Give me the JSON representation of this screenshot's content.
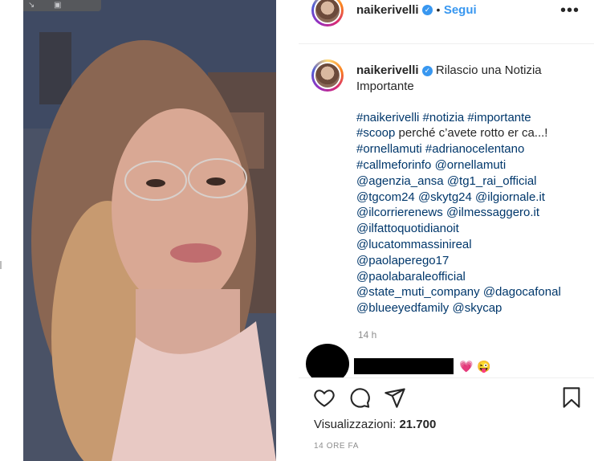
{
  "video_overlay": {
    "icon_left": "↘",
    "icon_right": "▣"
  },
  "header": {
    "username": "naikerivelli",
    "separator": "•",
    "follow_label": "Segui",
    "more_label": "•••"
  },
  "caption": {
    "username": "naikerivelli",
    "title": "Rilascio una Notizia Importante",
    "lines": [
      {
        "parts": [
          {
            "t": "#naikerivelli",
            "tag": true
          },
          {
            "t": " "
          },
          {
            "t": "#notizia",
            "tag": true
          },
          {
            "t": " "
          },
          {
            "t": "#importante",
            "tag": true
          }
        ]
      },
      {
        "parts": [
          {
            "t": "#scoop",
            "tag": true
          },
          {
            "t": " perché c’avete rotto er ca...!"
          }
        ]
      },
      {
        "parts": [
          {
            "t": "#ornellamuti",
            "tag": true
          },
          {
            "t": " "
          },
          {
            "t": "#adrianocelentano",
            "tag": true
          }
        ]
      },
      {
        "parts": [
          {
            "t": "#callmeforinfo",
            "tag": true
          },
          {
            "t": " "
          },
          {
            "t": "@ornellamuti",
            "tag": true
          }
        ]
      },
      {
        "parts": [
          {
            "t": "@agenzia_ansa",
            "tag": true
          },
          {
            "t": " "
          },
          {
            "t": "@tg1_rai_official",
            "tag": true
          }
        ]
      },
      {
        "parts": [
          {
            "t": "@tgcom24",
            "tag": true
          },
          {
            "t": " "
          },
          {
            "t": "@skytg24",
            "tag": true
          },
          {
            "t": " "
          },
          {
            "t": "@ilgiornale.it",
            "tag": true
          }
        ]
      },
      {
        "parts": [
          {
            "t": "@ilcorrierenews",
            "tag": true
          },
          {
            "t": " "
          },
          {
            "t": "@ilmessaggero.it",
            "tag": true
          }
        ]
      },
      {
        "parts": [
          {
            "t": "@ilfattoquotidianoit",
            "tag": true
          }
        ]
      },
      {
        "parts": [
          {
            "t": "@lucatommassinireal",
            "tag": true
          }
        ]
      },
      {
        "parts": [
          {
            "t": "@paolaperego17",
            "tag": true
          }
        ]
      },
      {
        "parts": [
          {
            "t": "@paolabaraleofficial",
            "tag": true
          }
        ]
      },
      {
        "parts": [
          {
            "t": "@state_muti_company",
            "tag": true
          },
          {
            "t": " "
          },
          {
            "t": "@dagocafonal",
            "tag": true
          }
        ]
      },
      {
        "parts": [
          {
            "t": "@blueeyedfamily",
            "tag": true
          },
          {
            "t": " "
          },
          {
            "t": "@skycap",
            "tag": true
          }
        ]
      }
    ],
    "time_ago": "14 h"
  },
  "comment": {
    "emoji_1": "💗",
    "emoji_2": "😜"
  },
  "actions": {
    "like_icon": "heart-icon",
    "comment_icon": "comment-icon",
    "share_icon": "share-icon",
    "save_icon": "bookmark-icon"
  },
  "stats": {
    "views_label": "Visualizzazioni:",
    "views_count": "21.700",
    "date": "14 ORE FA"
  },
  "colors": {
    "link": "#00376b",
    "follow": "#3897f0",
    "verified": "#3897f0",
    "muted": "#8e8e8e"
  }
}
